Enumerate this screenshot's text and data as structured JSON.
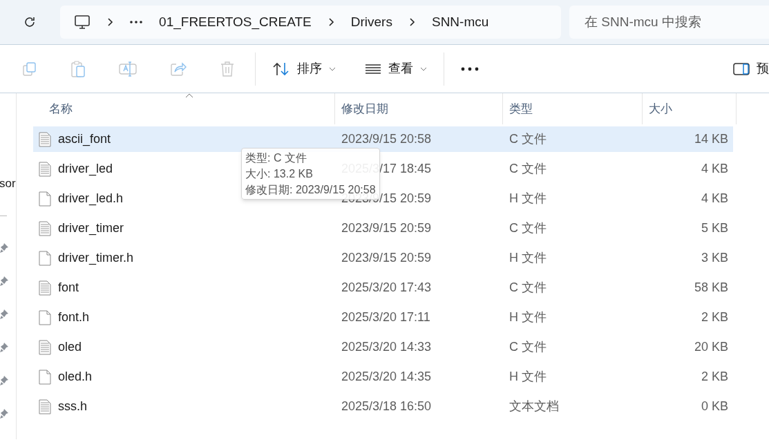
{
  "breadcrumb": {
    "items": [
      "01_FREERTOS_CREATE",
      "Drivers",
      "SNN-mcu"
    ]
  },
  "search": {
    "placeholder": "在 SNN-mcu 中搜索"
  },
  "toolbar": {
    "sort": "排序",
    "view": "查看",
    "preview": "预"
  },
  "sidebar": {
    "partial_label": "sor"
  },
  "table": {
    "columns": [
      "名称",
      "修改日期",
      "类型",
      "大小"
    ],
    "rows": [
      {
        "name": "ascii_font",
        "date": "2023/9/15 20:58",
        "type": "C 文件",
        "size": "14 KB",
        "kind": "text",
        "selected": true
      },
      {
        "name": "driver_led",
        "date": "2025/3/17 18:45",
        "type": "C 文件",
        "size": "4 KB",
        "kind": "text",
        "selected": false
      },
      {
        "name": "driver_led.h",
        "date": "2023/9/15 20:59",
        "type": "H 文件",
        "size": "4 KB",
        "kind": "blank",
        "selected": false
      },
      {
        "name": "driver_timer",
        "date": "2023/9/15 20:59",
        "type": "C 文件",
        "size": "5 KB",
        "kind": "text",
        "selected": false
      },
      {
        "name": "driver_timer.h",
        "date": "2023/9/15 20:59",
        "type": "H 文件",
        "size": "3 KB",
        "kind": "blank",
        "selected": false
      },
      {
        "name": "font",
        "date": "2025/3/20 17:43",
        "type": "C 文件",
        "size": "58 KB",
        "kind": "text",
        "selected": false
      },
      {
        "name": "font.h",
        "date": "2025/3/20 17:11",
        "type": "H 文件",
        "size": "2 KB",
        "kind": "blank",
        "selected": false
      },
      {
        "name": "oled",
        "date": "2025/3/20 14:33",
        "type": "C 文件",
        "size": "20 KB",
        "kind": "text",
        "selected": false
      },
      {
        "name": "oled.h",
        "date": "2025/3/20 14:35",
        "type": "H 文件",
        "size": "2 KB",
        "kind": "blank",
        "selected": false
      },
      {
        "name": "sss.h",
        "date": "2025/3/18 16:50",
        "type": "文本文档",
        "size": "0 KB",
        "kind": "text",
        "selected": false
      }
    ]
  },
  "tooltip": {
    "lines": [
      "类型: C 文件",
      "大小: 13.2 KB",
      "修改日期: 2023/9/15 20:58"
    ]
  }
}
